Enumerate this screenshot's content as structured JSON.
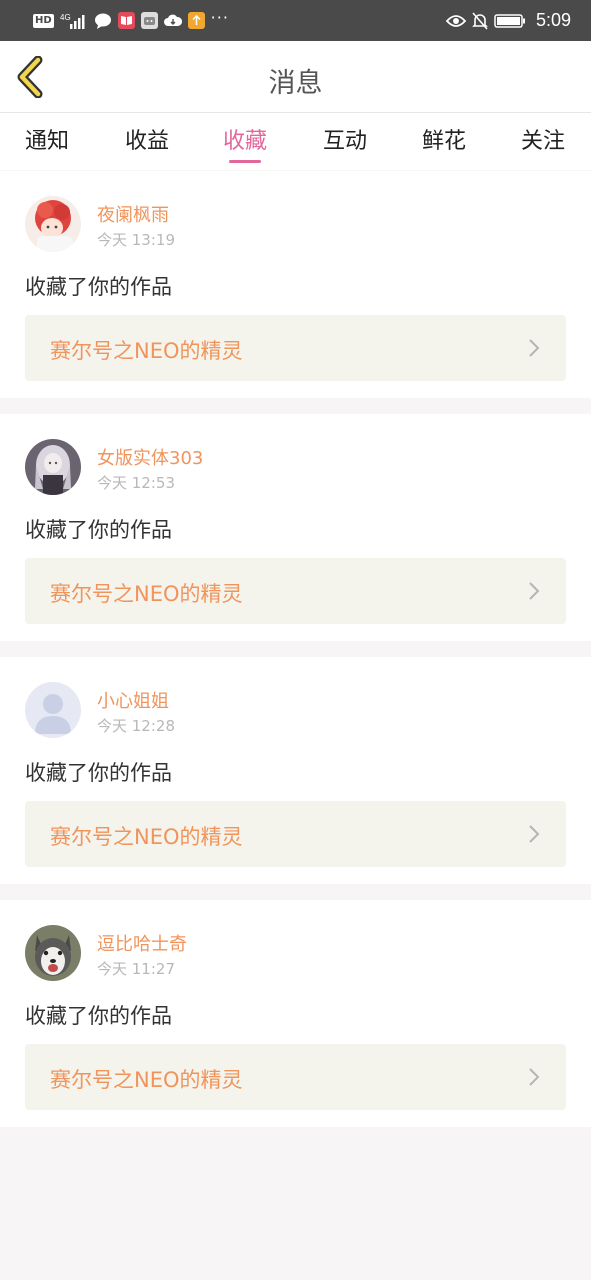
{
  "status_bar": {
    "hd": "HD",
    "network": "4G",
    "time": "5:09",
    "dots": "···"
  },
  "header": {
    "title": "消息",
    "back_icon": "chevron-left-icon",
    "accent_color": "#f2d64b"
  },
  "tabs": [
    {
      "label": "通知",
      "active": false
    },
    {
      "label": "收益",
      "active": false
    },
    {
      "label": "收藏",
      "active": true
    },
    {
      "label": "互动",
      "active": false
    },
    {
      "label": "鲜花",
      "active": false
    },
    {
      "label": "关注",
      "active": false
    }
  ],
  "colors": {
    "tab_active": "#e2689b",
    "username": "#f0945c",
    "work_bg": "#f4f4ec"
  },
  "messages": [
    {
      "username": "夜阑枫雨",
      "time": "今天 13:19",
      "action": "收藏了你的作品",
      "work": "赛尔号之NEO的精灵",
      "avatar": "anime-avatar-red-hair"
    },
    {
      "username": "女版实体303",
      "time": "今天 12:53",
      "action": "收藏了你的作品",
      "work": "赛尔号之NEO的精灵",
      "avatar": "anime-avatar-white-hair"
    },
    {
      "username": "小心姐姐",
      "time": "今天 12:28",
      "action": "收藏了你的作品",
      "work": "赛尔号之NEO的精灵",
      "avatar": "default-person-avatar"
    },
    {
      "username": "逗比哈士奇",
      "time": "今天 11:27",
      "action": "收藏了你的作品",
      "work": "赛尔号之NEO的精灵",
      "avatar": "husky-dog-avatar"
    }
  ]
}
